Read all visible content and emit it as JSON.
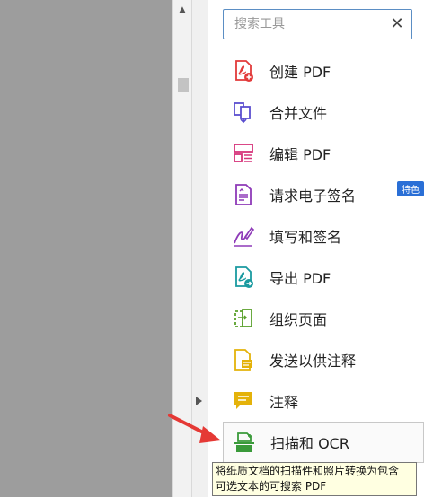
{
  "search": {
    "placeholder": "搜索工具",
    "clear_icon": "close-icon"
  },
  "tools": [
    {
      "label": "创建 PDF",
      "icon": "create-pdf-icon",
      "color": "#e23a3a"
    },
    {
      "label": "合并文件",
      "icon": "combine-files-icon",
      "color": "#5b4fcf"
    },
    {
      "label": "编辑 PDF",
      "icon": "edit-pdf-icon",
      "color": "#d6337a"
    },
    {
      "label": "请求电子签名",
      "icon": "request-signature-icon",
      "color": "#8e3ab8",
      "badge": "特色"
    },
    {
      "label": "填写和签名",
      "icon": "fill-sign-icon",
      "color": "#8e3ab8"
    },
    {
      "label": "导出 PDF",
      "icon": "export-pdf-icon",
      "color": "#1a9aa0"
    },
    {
      "label": "组织页面",
      "icon": "organize-pages-icon",
      "color": "#5aa02c"
    },
    {
      "label": "发送以供注释",
      "icon": "send-for-comments-icon",
      "color": "#e4b20a"
    },
    {
      "label": "注释",
      "icon": "comment-icon",
      "color": "#e4b20a"
    },
    {
      "label": "扫描和 OCR",
      "icon": "scan-ocr-icon",
      "color": "#3a9a3a",
      "selected": true
    }
  ],
  "tooltip": {
    "line1": "将纸质文档的扫描件和照片转换为包含",
    "line2": "可选文本的可搜索 PDF"
  },
  "colors": {
    "accent": "#2a6fd6",
    "search_border": "#5b8ec4",
    "tooltip_bg": "#ffffe1",
    "annotation_arrow": "#e53935"
  }
}
